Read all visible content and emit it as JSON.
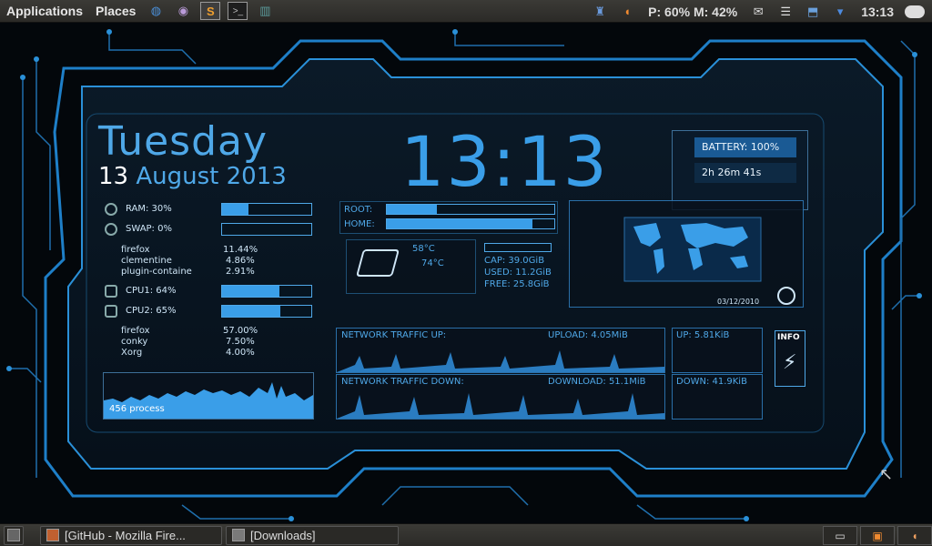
{
  "topbar": {
    "applications": "Applications",
    "places": "Places",
    "status": "P: 60% M: 42%",
    "clock": "13:13"
  },
  "widget": {
    "day": "Tuesday",
    "date_num": "13",
    "date_rest": "August 2013",
    "time": "13:13",
    "battery": "BATTERY: 100%",
    "battery_time": "2h 26m 41s",
    "ram": {
      "label": "RAM: 30%",
      "value": 30
    },
    "swap": {
      "label": "SWAP: 0%",
      "value": 0
    },
    "mem_procs": [
      {
        "name": "firefox",
        "value": "11.44%"
      },
      {
        "name": "clementine",
        "value": "4.86%"
      },
      {
        "name": "plugin-containe",
        "value": "2.91%"
      }
    ],
    "cpu1": {
      "label": "CPU1: 64%",
      "value": 64
    },
    "cpu2": {
      "label": "CPU2: 65%",
      "value": 65
    },
    "cpu_procs": [
      {
        "name": "firefox",
        "value": "57.00%"
      },
      {
        "name": "conky",
        "value": "7.50%"
      },
      {
        "name": "Xorg",
        "value": "4.00%"
      }
    ],
    "processes": "456  process",
    "root_label": "ROOT:",
    "home_label": "HOME:",
    "root_fill": 30,
    "home_fill": 87,
    "temp1": "58°C",
    "temp2": "74°C",
    "cap": "CAP: 39.0GiB",
    "used": "USED: 11.2GiB",
    "free": "FREE: 25.8GiB",
    "net_up_label": "NETWORK TRAFFIC UP:",
    "net_down_label": "NETWORK TRAFFIC DOWN:",
    "upload": "UPLOAD: 4.05MiB",
    "download": "DOWNLOAD: 51.1MiB",
    "up_speed": "UP: 5.81KiB",
    "down_speed": "DOWN: 41.9KiB",
    "info": "INFO",
    "map_date": "03/12/2010"
  },
  "taskbar": {
    "tasks": [
      "[GitHub - Mozilla Fire...",
      "[Downloads]"
    ]
  },
  "colors": {
    "accent": "#3a9ee8",
    "panel_border": "#1d4f74",
    "background": "#03070b"
  }
}
